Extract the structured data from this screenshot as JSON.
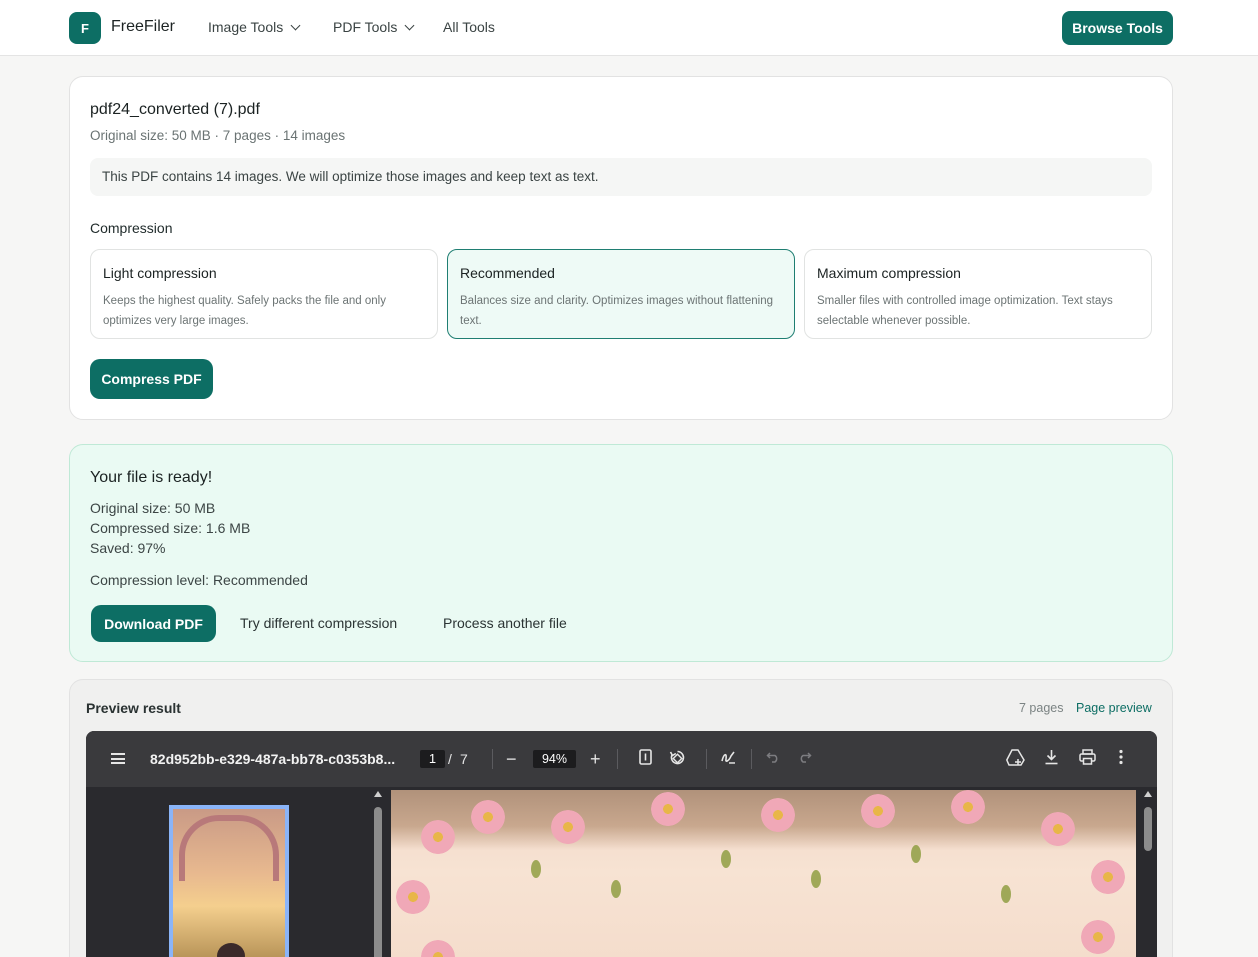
{
  "header": {
    "logo_letter": "F",
    "brand": "FreeFiler",
    "nav": [
      {
        "label": "Image Tools"
      },
      {
        "label": "PDF Tools"
      },
      {
        "label": "All Tools"
      }
    ],
    "cta": "Browse Tools"
  },
  "file": {
    "name": "pdf24_converted (7).pdf",
    "meta": "Original size: 50 MB · 7 pages · 14 images",
    "info": "This PDF contains 14 images. We will optimize those images and keep text as text."
  },
  "compression": {
    "label": "Compression",
    "options": [
      {
        "title": "Light compression",
        "desc": "Keeps the highest quality. Safely packs the file and only optimizes very large images.",
        "selected": false
      },
      {
        "title": "Recommended",
        "desc": "Balances size and clarity. Optimizes images without flattening text.",
        "selected": true
      },
      {
        "title": "Maximum compression",
        "desc": "Smaller files with controlled image optimization. Text stays selectable whenever possible.",
        "selected": false
      }
    ],
    "button": "Compress PDF"
  },
  "result": {
    "title": "Your file is ready!",
    "original": "Original size: 50 MB",
    "compressed": "Compressed size: 1.6 MB",
    "saved": "Saved: 97%",
    "level": "Compression level: Recommended",
    "download": "Download PDF",
    "try_different": "Try different compression",
    "process_another": "Process another file"
  },
  "preview": {
    "title": "Preview result",
    "pages": "7 pages",
    "page_preview": "Page preview"
  },
  "viewer": {
    "doc_title": "82d952bb-e329-487a-bb78-c0353b8...",
    "current_page": "1",
    "page_sep": "/",
    "total_pages": "7",
    "zoom": "94%",
    "minus": "−",
    "plus": "+"
  },
  "colors": {
    "accent": "#0d6e64",
    "success_bg": "#eafaf3",
    "viewer_bg": "#2a2a2e",
    "toolbar_bg": "#3a3a3d"
  },
  "icons": {
    "menu": "hamburger-icon",
    "fit_page": "fit-page-icon",
    "rotate": "rotate-icon",
    "draw": "draw-icon",
    "undo": "undo-icon",
    "redo": "redo-icon",
    "drive": "add-to-drive-icon",
    "download": "download-icon",
    "print": "print-icon",
    "more": "more-vertical-icon"
  }
}
